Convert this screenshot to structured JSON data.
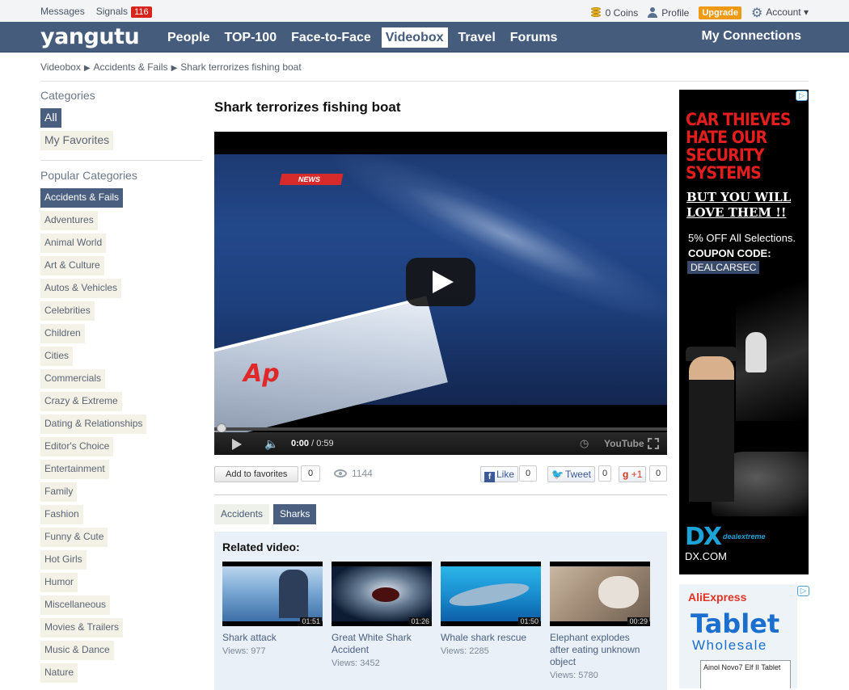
{
  "topbar": {
    "messages": "Messages",
    "signals": "Signals",
    "signals_count": "116",
    "coins": "0 Coins",
    "profile": "Profile",
    "upgrade": "Upgrade",
    "account": "Account ▾"
  },
  "nav": {
    "logo": "yangutu",
    "items": [
      "People",
      "TOP-100",
      "Face-to-Face",
      "Videobox",
      "Travel",
      "Forums"
    ],
    "active": "Videobox",
    "connections": "My Connections"
  },
  "breadcrumb": [
    "Videobox",
    "Accidents & Fails",
    "Shark terrorizes fishing boat"
  ],
  "sidebar": {
    "categories_heading": "Categories",
    "top_items": [
      "All",
      "My Favorites"
    ],
    "popular_heading": "Popular Categories",
    "popular": [
      "Accidents & Fails",
      "Adventures",
      "Animal World",
      "Art & Culture",
      "Autos & Vehicles",
      "Celebrities",
      "Children",
      "Cities",
      "Commercials",
      "Crazy & Extreme",
      "Dating & Relationships",
      "Editor's Choice",
      "Entertainment",
      "Family",
      "Fashion",
      "Funny & Cute",
      "Hot Girls",
      "Humor",
      "Miscellaneous",
      "Movies & Trailers",
      "Music & Dance",
      "Nature"
    ]
  },
  "video": {
    "title": "Shark terrorizes fishing boat",
    "news_label": "NEWS",
    "ap_logo": "Ap",
    "time_current": "0:00",
    "time_total": "/ 0:59",
    "youtube": "YouTube",
    "progress": 0
  },
  "actions": {
    "add_favorites": "Add to favorites",
    "fav_count": "0",
    "views": "1144",
    "like": "Like",
    "like_count": "0",
    "tweet": "Tweet",
    "tweet_count": "0",
    "gplus": "+1",
    "gplus_count": "0"
  },
  "tags": [
    "Accidents",
    "Sharks"
  ],
  "related": {
    "heading": "Related video:",
    "items": [
      {
        "title": "Shark attack",
        "views": "Views: 977",
        "duration": "01:51"
      },
      {
        "title": "Great White Shark Accident",
        "views": "Views: 3452",
        "duration": "01:26"
      },
      {
        "title": "Whale shark rescue",
        "views": "Views: 2285",
        "duration": "01:50"
      },
      {
        "title": "Elephant explodes after eating unknown object",
        "views": "Views: 5780",
        "duration": "00:29"
      }
    ]
  },
  "ad1": {
    "headline": "CAR THIEVES HATE OUR SECURITY SYSTEMS",
    "sub": "BUT YOU WILL LOVE THEM !!",
    "offer": "5% OFF All Selections.",
    "coupon_label": "COUPON CODE:",
    "coupon_code": "DEALCARSEC",
    "brand": "DX",
    "brand_sub": "dealextreme",
    "domain": "DX.COM"
  },
  "ad2": {
    "brand": "AliExpress",
    "title": "Tablet",
    "subtitle": "Wholesale",
    "device_text": "Ainol Novo7 Elf II Tablet"
  },
  "colors": {
    "nav": "#455c7c",
    "chip": "#f4f1e6",
    "chip_selected": "#4a5f80",
    "related_bg": "#eaf0f7",
    "signal_badge": "#d9241b",
    "upgrade": "#f09a14"
  }
}
